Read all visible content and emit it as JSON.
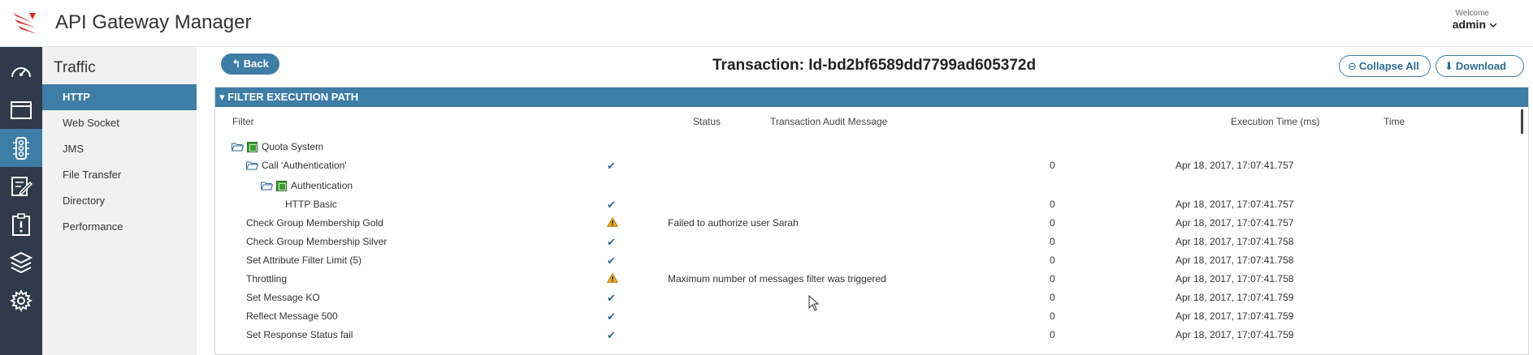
{
  "header": {
    "app_title": "API Gateway Manager",
    "welcome_label": "Welcome",
    "username": "admin",
    "user_menu_icon": "chevron-down-icon"
  },
  "rail": {
    "items": [
      {
        "icon": "dashboard-icon",
        "active": false
      },
      {
        "icon": "window-icon",
        "active": false
      },
      {
        "icon": "traffic-light-icon",
        "active": true
      },
      {
        "icon": "edit-icon",
        "active": false
      },
      {
        "icon": "alert-clipboard-icon",
        "active": false
      },
      {
        "icon": "layers-icon",
        "active": false
      },
      {
        "icon": "gear-icon",
        "active": false
      }
    ]
  },
  "subnav": {
    "title": "Traffic",
    "items": [
      {
        "label": "HTTP",
        "active": true
      },
      {
        "label": "Web Socket",
        "active": false
      },
      {
        "label": "JMS",
        "active": false
      },
      {
        "label": "File Transfer",
        "active": false
      },
      {
        "label": "Directory",
        "active": false
      },
      {
        "label": "Performance",
        "active": false
      }
    ]
  },
  "toolbar": {
    "back_label": "Back",
    "transaction_title": "Transaction: Id-bd2bf6589dd7799ad605372d",
    "collapse_label": "Collapse All",
    "download_label": "Download"
  },
  "panel": {
    "title": "FILTER EXECUTION PATH",
    "columns": {
      "filter": "Filter",
      "status": "Status",
      "message": "Transaction Audit Message",
      "exec_time": "Execution Time (ms)",
      "time": "Time"
    },
    "rows": [
      {
        "name": "Quota System",
        "depth": 0,
        "kind": "group",
        "status": "",
        "message": "",
        "exec_time": "",
        "time": ""
      },
      {
        "name": "Call 'Authentication'",
        "depth": 1,
        "kind": "folder",
        "status": "ok",
        "message": "",
        "exec_time": "0",
        "time": "Apr 18, 2017, 17:07:41.757"
      },
      {
        "name": "Authentication",
        "depth": 2,
        "kind": "group",
        "status": "",
        "message": "",
        "exec_time": "",
        "time": ""
      },
      {
        "name": "HTTP Basic",
        "depth": 3,
        "kind": "leaf",
        "status": "ok",
        "message": "",
        "exec_time": "0",
        "time": "Apr 18, 2017, 17:07:41.757"
      },
      {
        "name": "Check Group Membership Gold",
        "depth": 1,
        "kind": "leaf",
        "status": "warn",
        "message": "Failed to authorize user Sarah",
        "exec_time": "0",
        "time": "Apr 18, 2017, 17:07:41.757"
      },
      {
        "name": "Check Group Membership Silver",
        "depth": 1,
        "kind": "leaf",
        "status": "ok",
        "message": "",
        "exec_time": "0",
        "time": "Apr 18, 2017, 17:07:41.758"
      },
      {
        "name": "Set Attribute Filter Limit (5)",
        "depth": 1,
        "kind": "leaf",
        "status": "ok",
        "message": "",
        "exec_time": "0",
        "time": "Apr 18, 2017, 17:07:41.758"
      },
      {
        "name": "Throttling",
        "depth": 1,
        "kind": "leaf",
        "status": "warn",
        "message": "Maximum number of messages filter was triggered",
        "exec_time": "0",
        "time": "Apr 18, 2017, 17:07:41.758"
      },
      {
        "name": "Set Message KO",
        "depth": 1,
        "kind": "leaf",
        "status": "ok",
        "message": "",
        "exec_time": "0",
        "time": "Apr 18, 2017, 17:07:41.759"
      },
      {
        "name": "Reflect Message 500",
        "depth": 1,
        "kind": "leaf",
        "status": "ok",
        "message": "",
        "exec_time": "0",
        "time": "Apr 18, 2017, 17:07:41.759"
      },
      {
        "name": "Set Response Status fail",
        "depth": 1,
        "kind": "leaf",
        "status": "ok",
        "message": "",
        "exec_time": "0",
        "time": "Apr 18, 2017, 17:07:41.759"
      }
    ]
  },
  "colors": {
    "accent": "#3d7da6",
    "rail_bg": "#2f3b4a",
    "subnav_bg": "#f1f1f1",
    "warning": "#e0a526",
    "logo_red": "#d92b2b"
  }
}
